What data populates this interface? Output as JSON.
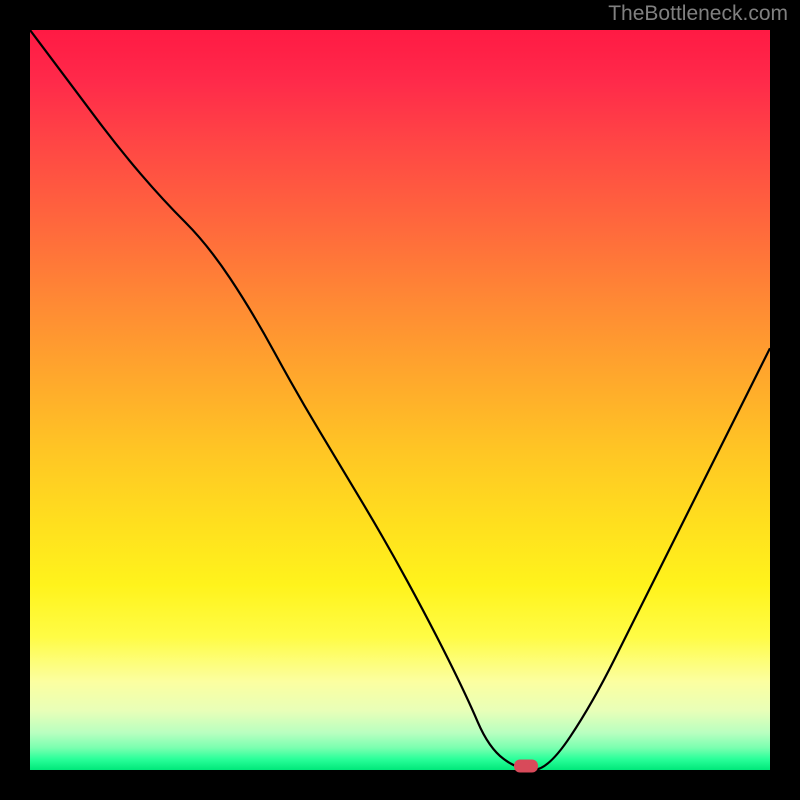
{
  "watermark": "TheBottleneck.com",
  "chart_data": {
    "type": "line",
    "title": "",
    "xlabel": "",
    "ylabel": "",
    "xlim": [
      0,
      100
    ],
    "ylim": [
      0,
      100
    ],
    "background_gradient": {
      "top_color": "#ff1a44",
      "bottom_color": "#00e87a",
      "description": "red to green vertical gradient (bottleneck severity)"
    },
    "series": [
      {
        "name": "bottleneck-curve",
        "color": "#000000",
        "x": [
          0,
          6,
          12,
          18,
          24,
          30,
          36,
          42,
          48,
          54,
          59,
          62,
          66,
          70,
          76,
          82,
          88,
          94,
          100
        ],
        "y": [
          100,
          92,
          84,
          77,
          71,
          62,
          51,
          41,
          31,
          20,
          10,
          3,
          0,
          0,
          9,
          21,
          33,
          45,
          57
        ]
      }
    ],
    "marker": {
      "name": "optimal-point",
      "x": 67,
      "y": 0,
      "color": "#d84a5a"
    }
  }
}
